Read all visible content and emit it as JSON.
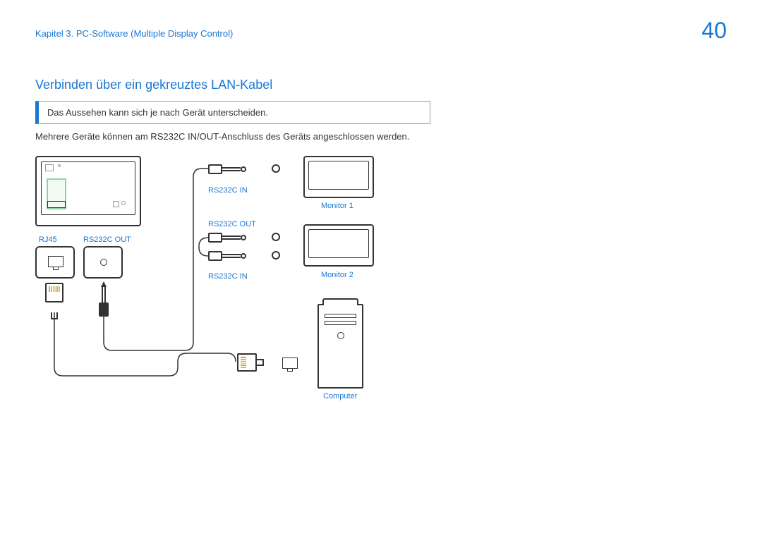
{
  "header": {
    "breadcrumb": "Kapitel 3. PC-Software (Multiple Display Control)",
    "page_number": "40"
  },
  "section": {
    "title": "Verbinden über ein gekreuztes LAN-Kabel",
    "note": "Das Aussehen kann sich je nach Gerät unterscheiden.",
    "body": "Mehrere Geräte können am RS232C IN/OUT-Anschluss des Geräts angeschlossen werden."
  },
  "labels": {
    "rj45": "RJ45",
    "rs232c_out": "RS232C OUT",
    "rs232c_in": "RS232C IN",
    "monitor1": "Monitor 1",
    "monitor2": "Monitor 2",
    "computer": "Computer"
  }
}
